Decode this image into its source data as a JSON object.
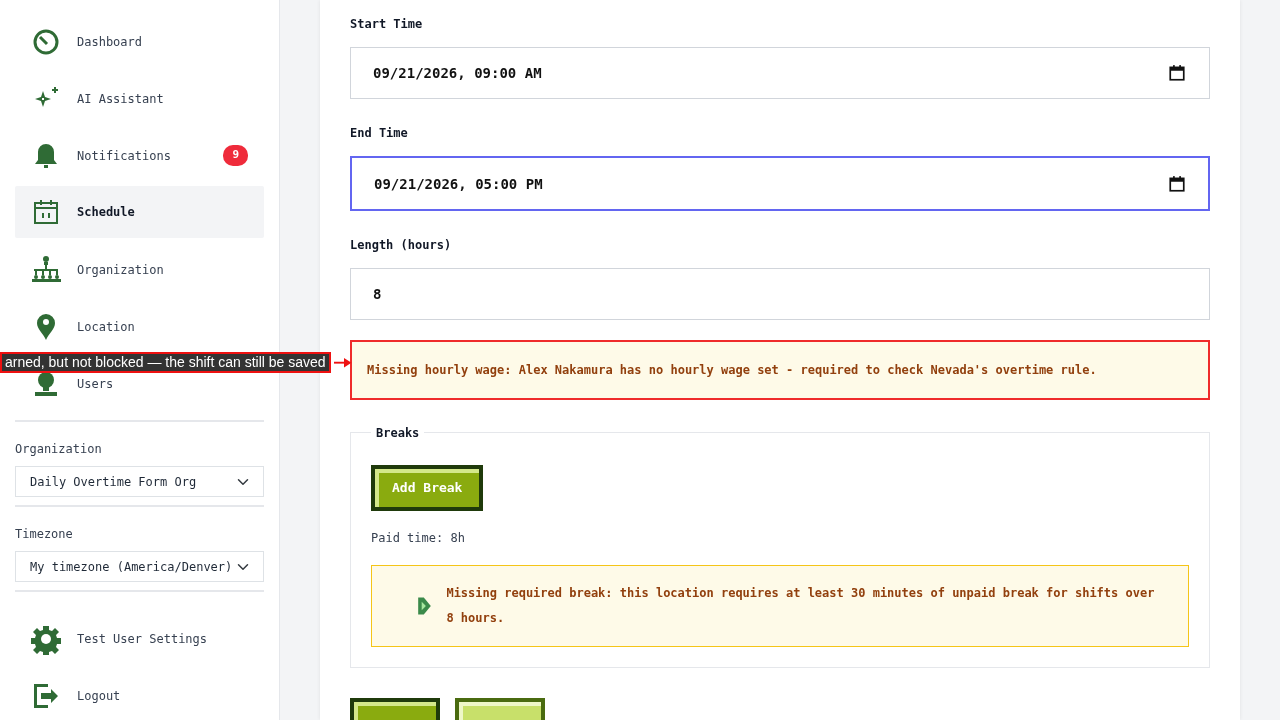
{
  "sidebar": {
    "nav": [
      {
        "label": "Dashboard",
        "selected": false
      },
      {
        "label": "AI Assistant",
        "selected": false
      },
      {
        "label": "Notifications",
        "selected": false,
        "badge": "9"
      },
      {
        "label": "Schedule",
        "selected": true
      },
      {
        "label": "Organization",
        "selected": false
      },
      {
        "label": "Location",
        "selected": false
      },
      {
        "label": "Users",
        "selected": false
      }
    ],
    "organization": {
      "label": "Organization",
      "value": "Daily Overtime Form Org"
    },
    "timezone": {
      "label": "Timezone",
      "value": "My timezone (America/Denver)"
    },
    "footer": [
      {
        "label": "Test User Settings"
      },
      {
        "label": "Logout"
      }
    ]
  },
  "form": {
    "fields": [
      {
        "kind": "datetime",
        "label": "Start Time",
        "value": "09/21/2026, 09:00 AM",
        "focused": false
      },
      {
        "kind": "datetime",
        "label": "End Time",
        "value": "09/21/2026, 05:00 PM",
        "focused": true
      },
      {
        "kind": "number",
        "label": "Length (hours)",
        "value": "8",
        "focused": false
      }
    ],
    "wage_warning": "Missing hourly wage: Alex Nakamura has no hourly wage set - required to check Nevada's overtime rule.",
    "breaks": {
      "legend": "Breaks",
      "add_button": "Add Break",
      "paid_time": "Paid time: 8h",
      "warning": "Missing required break: this location requires at least 30 minutes of unpaid break for shifts over 8 hours."
    },
    "buttons": [
      {
        "kind": "primary"
      },
      {
        "kind": "secondary"
      }
    ]
  },
  "annotation": "arned, but not blocked — the shift can still be saved"
}
